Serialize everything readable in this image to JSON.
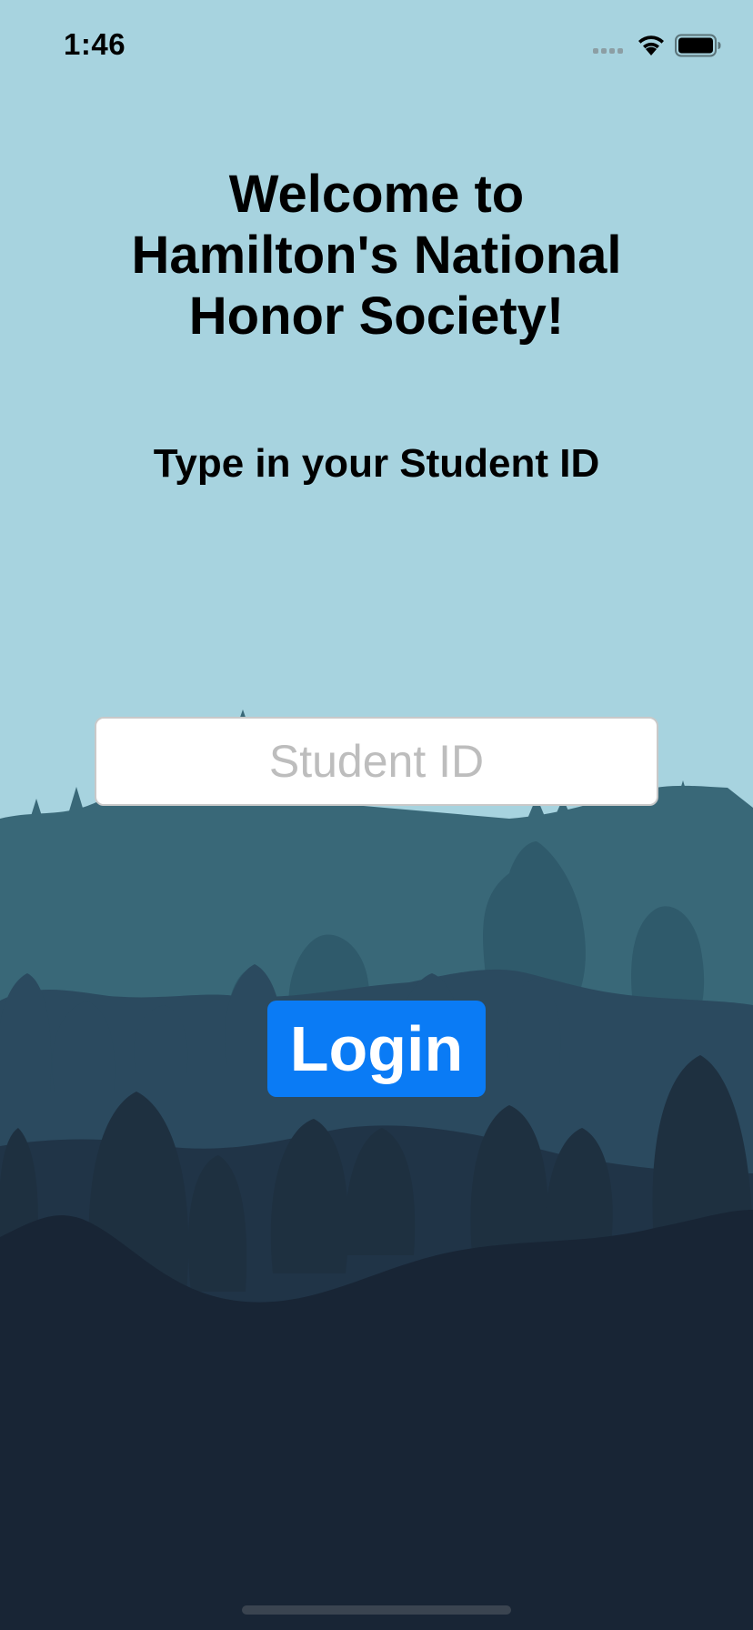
{
  "status_bar": {
    "time": "1:46",
    "icons": [
      "signal-icon",
      "wifi-icon",
      "battery-icon"
    ]
  },
  "welcome": {
    "title": "Welcome to\nHamilton's National\nHonor Society!"
  },
  "instruction": {
    "label": "Type in your Student ID"
  },
  "student_id": {
    "placeholder": "Student ID",
    "value": ""
  },
  "login": {
    "label": "Login"
  },
  "colors": {
    "sky": "#a7d3df",
    "hills_far": "#396878",
    "hills_mid": "#2b4a5f",
    "hills_near": "#182535",
    "button": "#0a7bf5"
  }
}
